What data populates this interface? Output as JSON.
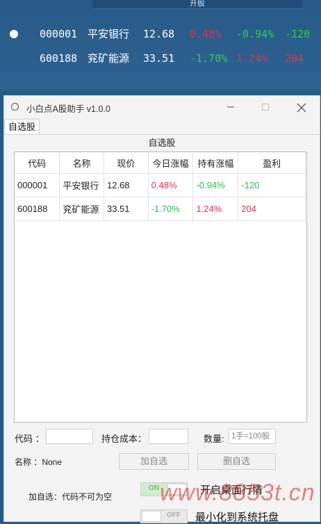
{
  "desktop": {
    "top_strip_label": "开股",
    "ticker": [
      {
        "code": "000001",
        "name": "平安银行",
        "price": "12.68",
        "today": "0.48%",
        "hold": "-0.94%",
        "pl": "-120",
        "today_color": "#e0334f",
        "hold_color": "#2ecc52",
        "pl_color": "#2ecc52"
      },
      {
        "code": "600188",
        "name": "兖矿能源",
        "price": "33.51",
        "today": "-1.70%",
        "hold": "1.24%",
        "pl": "204",
        "today_color": "#2ecc52",
        "hold_color": "#e0334f",
        "pl_color": "#e0334f"
      }
    ]
  },
  "window": {
    "title": "小白点A股助手   v1.0.0",
    "tab_label": "自选股",
    "section_title": "自选股",
    "table": {
      "headers": [
        "代码",
        "名称",
        "现价",
        "今日涨幅",
        "持有涨幅",
        "盈利"
      ],
      "rows": [
        {
          "code": "000001",
          "name": "平安银行",
          "price": "12.68",
          "today": "0.48%",
          "hold": "-0.94%",
          "pl": "-120",
          "today_color": "#e0334f",
          "hold_color": "#1ec24b",
          "pl_color": "#1ec24b"
        },
        {
          "code": "600188",
          "name": "兖矿能源",
          "price": "33.51",
          "today": "-1.70%",
          "hold": "1.24%",
          "pl": "204",
          "today_color": "#1ec24b",
          "hold_color": "#e0334f",
          "pl_color": "#e0334f"
        }
      ]
    },
    "form": {
      "code_label": "代码 ：",
      "code_value": "",
      "cost_label": "持仓成本：",
      "cost_value": "",
      "qty_label": "数量:",
      "qty_placeholder": "1手=100股",
      "name_label": "名称 ：None",
      "add_button": "加自选",
      "remove_button": "删自选",
      "status_text": "加自选：代码不可为空"
    },
    "toggles": [
      {
        "state": "ON",
        "label": "开启桌面行情",
        "on": true
      },
      {
        "state": "OFF",
        "label": "最小化到系统托盘",
        "on": false
      }
    ]
  },
  "watermark": "www.8853t.cn",
  "colors": {
    "up": "#e0334f",
    "down": "#1ec24b",
    "toggle_on": "#cfeccd"
  }
}
